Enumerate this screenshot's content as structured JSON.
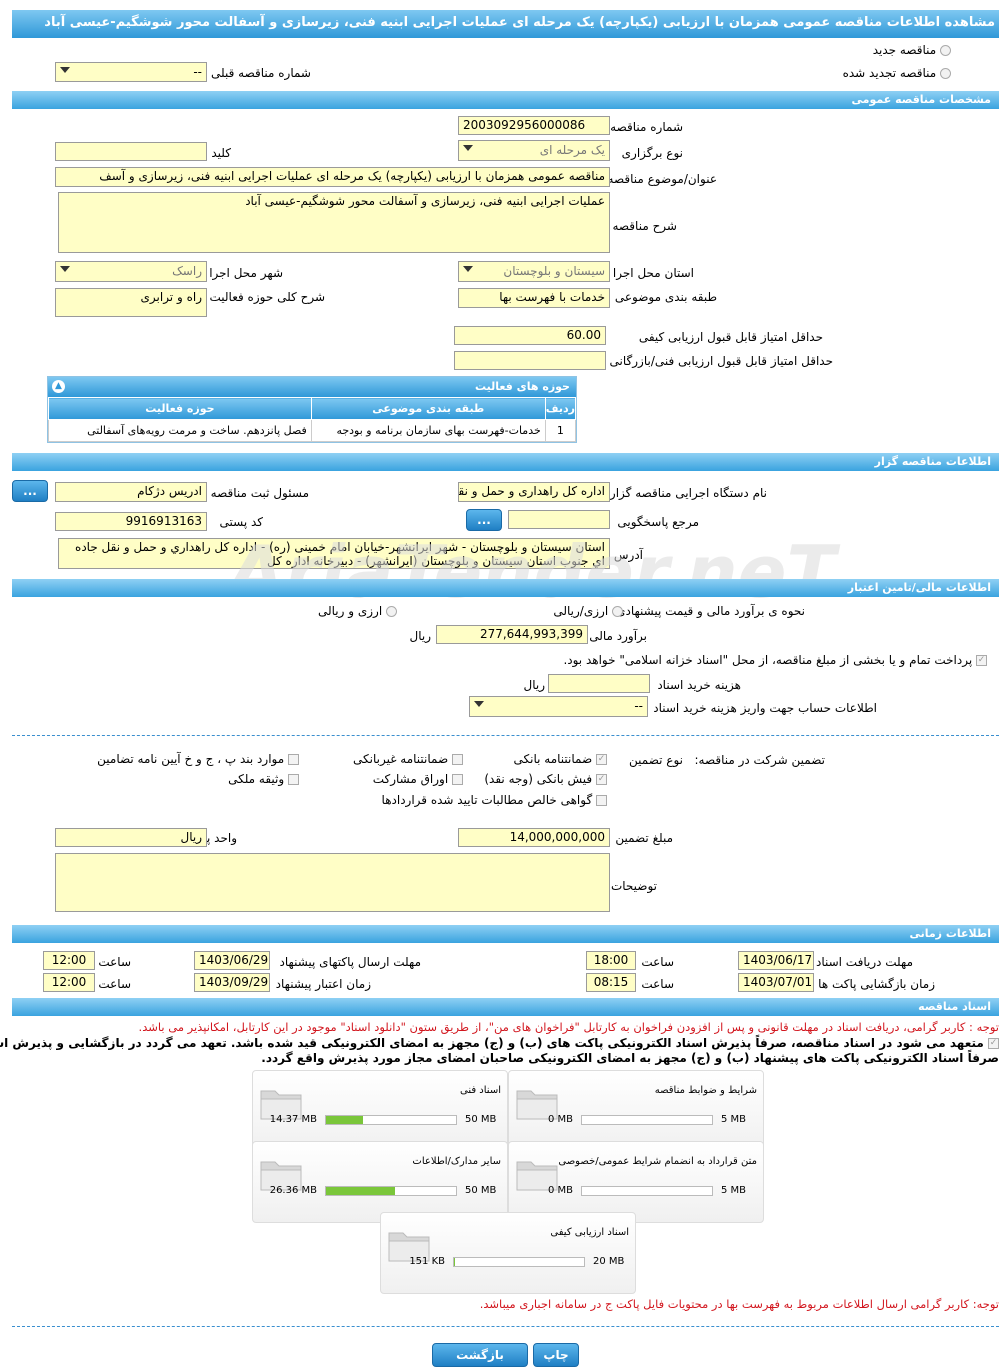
{
  "title": "مشاهده اطلاعات مناقصه عمومی همزمان با ارزیابی (یکپارچه) یک مرحله ای عملیات اجرایی ابنیه فنی، زیرسازی و آسفالت محور شوشگیم-عیسی آباد",
  "top": {
    "new_tender": "مناقصه جدید",
    "renewed_tender": "مناقصه تجدید شده",
    "prev_tender_label": "شماره مناقصه قبلی",
    "prev_tender_value": "--"
  },
  "general": {
    "header": "مشخصات مناقصه عمومی",
    "number_label": "شماره مناقصه",
    "number_value": "2003092956000086",
    "type_label": "نوع برگزاری",
    "type_value": "یک مرحله ای",
    "keyword_label": "کلید واژه",
    "subject_label": "عنوان/موضوع مناقصه",
    "subject_value": "مناقصه عمومی همزمان با ارزیابی (یکپارچه) یک مرحله ای عملیات اجرایی ابنیه فنی، زیرسازی و آسف",
    "desc_label": "شرح مناقصه",
    "desc_value": "عملیات اجرایی ابنیه فنی، زیرسازی و آسفالت محور شوشگیم-عیسی آباد",
    "province_label": "استان محل اجرا",
    "province_value": "سیستان و بلوچستان",
    "city_label": "شهر محل اجرا",
    "city_value": "راسک",
    "category_label": "طبقه بندی موضوعی",
    "category_value": "خدمات با فهرست بها",
    "scope_label": "شرح کلی حوزه فعالیت",
    "scope_value": "راه و ترابری",
    "min_quality_label": "حداقل امتیاز قابل قبول ارزیابی کیفی",
    "min_quality_value": "60.00",
    "min_tech_label": "حداقل امتیاز قابل قبول ارزیابی فنی/بازرگانی"
  },
  "activity": {
    "header": "حوزه های فعالیت",
    "columns": [
      "ردیف",
      "طبقه بندی موضوعی",
      "حوزه فعالیت"
    ],
    "rows": [
      [
        "1",
        "خدمات-فهرست بهای سازمان برنامه و بودجه",
        "فصل پانزدهم. ساخت و مرمت رویه‌های آسفالتی"
      ]
    ]
  },
  "organizer": {
    "header": "اطلاعات مناقصه گزار",
    "org_label": "نام دستگاه اجرایی مناقصه گزار",
    "org_value": "اداره کل راهداری و حمل و نقل",
    "registrar_label": "مسئول ثبت مناقصه",
    "registrar_value": "ادریس دژکام",
    "ref_label": "مرجع پاسخگویی",
    "postal_label": "کد پستی",
    "postal_value": "9916913163",
    "address_label": "آدرس",
    "address_value": "استان سیستان و بلوچستان - شهر ایرانشهر-خیابان امام خمینی (ره) - اداره کل راهداري و حمل و نقل جاده اي جنوب استان سیستان و بلوچستان (ایرانشهر) - دبیرخانه اداره کل",
    "dots": "..."
  },
  "finance": {
    "header": "اطلاعات مالی/تامین اعتبار",
    "method_label": "نحوه ی برآورد مالی و قیمت پیشنهادی",
    "opt1": "ارزی/ریالی",
    "opt2": "ارزی و ریالی",
    "estimate_label": "برآورد مالی",
    "estimate_value": "277,644,993,399",
    "rial": "ریال",
    "treasury_note": "پرداخت تمام و یا بخشی از مبلغ مناقصه، از محل \"اسناد خزانه اسلامی\" خواهد بود.",
    "doc_cost_label": "هزینه خرید اسناد",
    "account_label": "اطلاعات حساب جهت واریز هزینه خرید اسناد",
    "account_value": "--"
  },
  "guarantee": {
    "participation_label": "تضمین شرکت در مناقصه:",
    "type_label": "نوع تضمین",
    "items": [
      "ضمانتنامه بانکی",
      "ضمانتنامه غیربانکی",
      "موارد بند پ ، ج و خ آیین نامه تضامین",
      "فیش بانکی (وجه نقد)",
      "اوراق مشارکت",
      "وثیقه ملکی",
      "گواهی خالص مطالبات تایید شده قراردادها"
    ],
    "amount_label": "مبلغ تضمین",
    "amount_value": "14,000,000,000",
    "unit_label": "واحد پول",
    "unit_value": "ریال",
    "notes_label": "توضیحات"
  },
  "timing": {
    "header": "اطلاعات زمانی",
    "receive_label": "مهلت دریافت اسناد",
    "receive_date": "1403/06/17",
    "receive_time": "18:00",
    "send_label": "مهلت ارسال پاکتهای پیشنهاد",
    "send_date": "1403/06/29",
    "send_time": "12:00",
    "open_label": "زمان بازگشایی پاکت ها",
    "open_date": "1403/07/01",
    "open_time": "08:15",
    "valid_label": "زمان اعتبار پیشنهاد",
    "valid_date": "1403/09/29",
    "valid_time": "12:00",
    "time_label": "ساعت"
  },
  "docs": {
    "header": "اسناد مناقصه",
    "note1": "توجه : کاربر گرامی، دریافت اسناد در مهلت قانونی و پس از افزودن فراخوان به کارتابل \"فراخوان های من\"، از طریق ستون \"دانلود اسناد\" موجود در این کارتابل، امکانپذیر می باشد.",
    "note2a": "متعهد می شود در اسناد مناقصه، صرفاً پذیرش اسناد الکترونیکی پاکت های (ب) و (ج) مجهز به امضای الکترونیکی قید شده باشد. تعهد می گردد در بازگشایی و پذیرش اسناد،",
    "note2b": "صرفاً اسناد الکترونیکی پاکت های پیشنهاد (ب) و (ج) مجهز به امضای الکترونیکی صاحبان امضای مجاز مورد پذیرش واقع گردد.",
    "files": [
      {
        "name": "شرایط و ضوابط مناقصه",
        "current": "0 MB",
        "max": "5 MB",
        "fill": 0
      },
      {
        "name": "اسناد فنی",
        "current": "14.37 MB",
        "max": "50 MB",
        "fill": 0.2874
      },
      {
        "name": "متن قرارداد به انضمام شرایط عمومی/خصوصی",
        "current": "0 MB",
        "max": "5 MB",
        "fill": 0
      },
      {
        "name": "سایر مدارک/اطلاعات",
        "current": "26.36 MB",
        "max": "50 MB",
        "fill": 0.5272
      },
      {
        "name": "اسناد ارزیابی کیفی",
        "current": "151 KB",
        "max": "20 MB",
        "fill": 0.0075
      }
    ],
    "note3": "توجه: کاربر گرامی ارسال اطلاعات مربوط به فهرست بها در محتویات فایل پاکت ج در سامانه اجباری میباشد."
  },
  "actions": {
    "print": "چاپ",
    "back": "بازگشت"
  },
  "watermark": "AriaTender.neT"
}
